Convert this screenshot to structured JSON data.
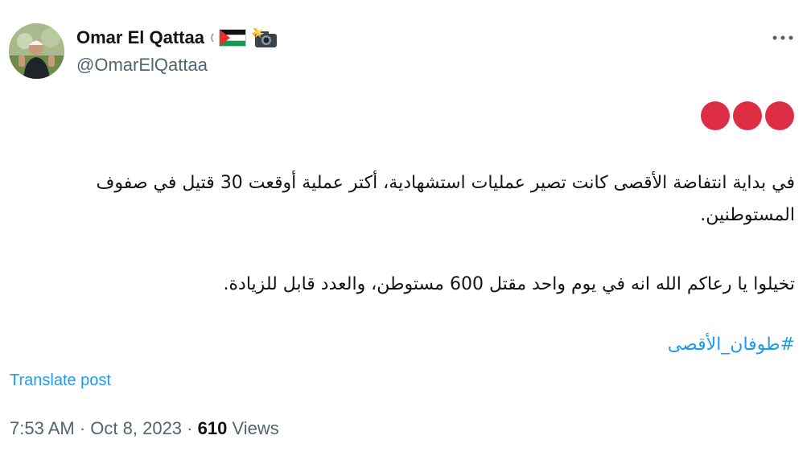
{
  "author": {
    "display_name": "Omar El Qattaa",
    "handle": "@OmarElQattaa",
    "name_icons": [
      "palestine-flag-icon",
      "camera-flash-icon"
    ]
  },
  "post": {
    "paragraph_1": "في بداية انتفاضة الأقصى كانت تصير عمليات استشهادية، أكتر عملية أوقعت 30 قتيل في صفوف المستوطنين.",
    "paragraph_2": "تخيلوا يا رعاكم الله انه في يوم واحد مقتل 600 مستوطن، والعدد قابل للزيادة.",
    "hashtag": "#طوفان_الأقصى",
    "emoji": "red-circle-icon x3"
  },
  "translate_label": "Translate post",
  "meta": {
    "time": "7:53 AM",
    "separator": "·",
    "date": "Oct 8, 2023",
    "views_count": "610",
    "views_label": "Views"
  },
  "colors": {
    "link": "#1d9bf0",
    "text": "#0f1419",
    "secondary": "#536471",
    "red_circle": "#dd2e44"
  }
}
